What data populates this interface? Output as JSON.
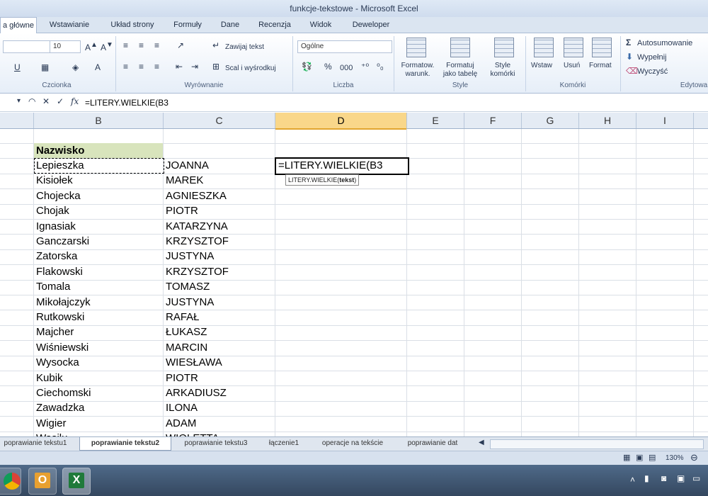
{
  "window": {
    "title": "funkcje-tekstowe - Microsoft Excel"
  },
  "ribbon_tabs": [
    "a główne",
    "Wstawianie",
    "Układ strony",
    "Formuły",
    "Dane",
    "Recenzja",
    "Widok",
    "Deweloper"
  ],
  "ribbon": {
    "font_size": "10",
    "wrap_text": "Zawijaj tekst",
    "merge_center": "Scal i wyśrodkuj",
    "number_format": "Ogólne",
    "percent": "%",
    "thousands": "000",
    "cond_format": "Formatow. warunk.",
    "format_table": "Formatuj jako tabelę",
    "cell_styles": "Style komórki",
    "insert": "Wstaw",
    "delete": "Usuń",
    "format": "Format",
    "autosum": "Autosumowanie",
    "fill": "Wypełnij",
    "clear": "Wyczyść",
    "groups": {
      "font": "Czcionka",
      "alignment": "Wyrównanie",
      "number": "Liczba",
      "styles": "Style",
      "cells": "Komórki",
      "editing": "Edytowa"
    }
  },
  "formula_bar": {
    "formula": "=LITERY.WIELKIE(B3"
  },
  "columns": [
    "B",
    "C",
    "D",
    "E",
    "F",
    "G",
    "H",
    "I"
  ],
  "sheet": {
    "header": "Nazwisko",
    "rows": [
      {
        "b": "Lepieszka",
        "c": "JOANNA"
      },
      {
        "b": "Kisiołek",
        "c": "MAREK"
      },
      {
        "b": "Chojecka",
        "c": "AGNIESZKA"
      },
      {
        "b": "Chojak",
        "c": "PIOTR"
      },
      {
        "b": "Ignasiak",
        "c": "KATARZYNA"
      },
      {
        "b": "Ganczarski",
        "c": "KRZYSZTOF"
      },
      {
        "b": "Zatorska",
        "c": "JUSTYNA"
      },
      {
        "b": "Flakowski",
        "c": "KRZYSZTOF"
      },
      {
        "b": "Tomala",
        "c": "TOMASZ"
      },
      {
        "b": "Mikołajczyk",
        "c": "JUSTYNA"
      },
      {
        "b": "Rutkowski",
        "c": "RAFAŁ"
      },
      {
        "b": "Majcher",
        "c": "ŁUKASZ"
      },
      {
        "b": "Wiśniewski",
        "c": "MARCIN"
      },
      {
        "b": "Wysocka",
        "c": "WIESŁAWA"
      },
      {
        "b": "Kubik",
        "c": "PIOTR"
      },
      {
        "b": "Ciechomski",
        "c": "ARKADIUSZ"
      },
      {
        "b": "Zawadzka",
        "c": "ILONA"
      },
      {
        "b": "Wigier",
        "c": "ADAM"
      },
      {
        "b": "Wasilu",
        "c": "WIOLETTA"
      }
    ],
    "editing_cell_text": "=LITERY.WIELKIE(B3",
    "tooltip_fn": "LITERY.WIELKIE(",
    "tooltip_arg": "tekst",
    "tooltip_close": ")"
  },
  "sheet_tabs": [
    "poprawianie tekstu1",
    "poprawianie tekstu2",
    "poprawianie tekstu3",
    "łączenie1",
    "operacje na tekście",
    "poprawianie dat"
  ],
  "active_sheet_index": 1,
  "status": {
    "zoom": "130%"
  }
}
